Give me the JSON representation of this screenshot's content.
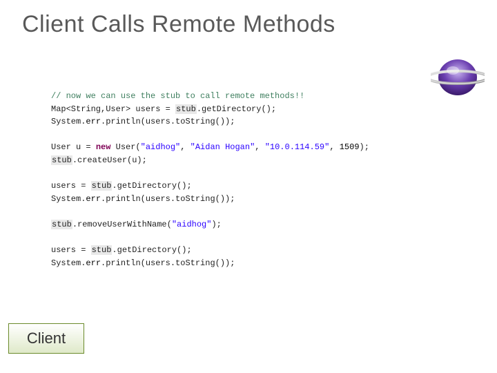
{
  "title": "Client Calls Remote Methods",
  "client_label": "Client",
  "code": {
    "comment": "// now we can use the stub to call remote methods!!",
    "line1a": "Map<String,User> users = ",
    "stub": "stub",
    "line1b": ".getDirectory();",
    "line2a": "System.",
    "err": "err",
    "line2b": ".println(users.toString());",
    "line3a": "User u = ",
    "kw_new": "new",
    "line3b": " User(",
    "s_aidhog": "\"aidhog\"",
    "comma": ", ",
    "s_name": "\"Aidan Hogan\"",
    "s_ip": "\"10.0.114.59\"",
    "num_port": "1509",
    "line3c": ");",
    "line4": ".createUser(u);",
    "line5a": "users = ",
    "line5b": ".getDirectory();",
    "line6": ".removeUserWithName(",
    "line6b": ");"
  }
}
